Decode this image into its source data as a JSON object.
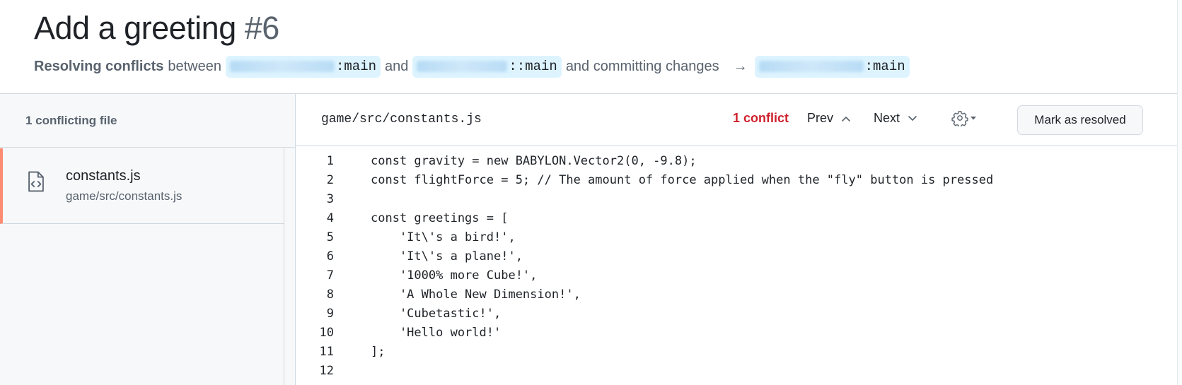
{
  "header": {
    "title": "Add a greeting",
    "number": "#6",
    "resolving": "Resolving conflicts",
    "between": "between",
    "and": "and",
    "committing": "and committing changes",
    "arrow": "→",
    "base_branch": ":main",
    "head_branch": "::main",
    "target_branch": ":main"
  },
  "sidebar": {
    "heading": "1 conflicting file",
    "file": {
      "name": "constants.js",
      "path": "game/src/constants.js",
      "icon": "file-code-icon"
    }
  },
  "toolbar": {
    "path": "game/src/constants.js",
    "conflict": "1 conflict",
    "prev": "Prev",
    "next": "Next",
    "mark_resolved": "Mark as resolved",
    "gear_icon": "gear-icon"
  },
  "code": {
    "lines": [
      {
        "n": "1",
        "text": "const gravity = new BABYLON.Vector2(0, -9.8);"
      },
      {
        "n": "2",
        "text": "const flightForce = 5; // The amount of force applied when the \"fly\" button is pressed"
      },
      {
        "n": "3",
        "text": ""
      },
      {
        "n": "4",
        "text": "const greetings = ["
      },
      {
        "n": "5",
        "text": "    'It\\'s a bird!',"
      },
      {
        "n": "6",
        "text": "    'It\\'s a plane!',"
      },
      {
        "n": "7",
        "text": "    '1000% more Cube!',"
      },
      {
        "n": "8",
        "text": "    'A Whole New Dimension!',"
      },
      {
        "n": "9",
        "text": "    'Cubetastic!',"
      },
      {
        "n": "10",
        "text": "    'Hello world!'"
      },
      {
        "n": "11",
        "text": "];"
      },
      {
        "n": "12",
        "text": ""
      }
    ]
  },
  "colors": {
    "conflict": "#cf222e",
    "branch_bg": "#ddf4ff",
    "active_file_accent": "#fd8c73"
  }
}
